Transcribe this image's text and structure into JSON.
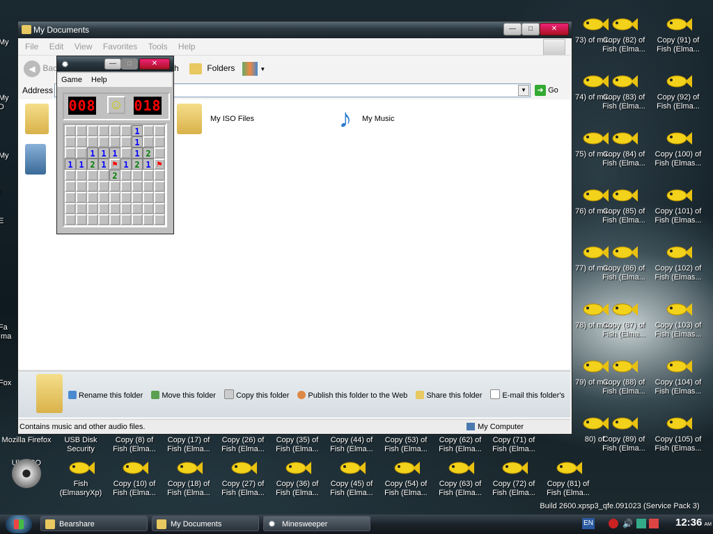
{
  "explorer": {
    "title": "My Documents",
    "menu": [
      "File",
      "Edit",
      "View",
      "Favorites",
      "Tools",
      "Help"
    ],
    "toolbar": {
      "back": "Back",
      "search": "h",
      "folders": "Folders"
    },
    "address_label": "Address",
    "go_label": "Go",
    "folders": [
      {
        "label": "My ISO Files"
      },
      {
        "label": "My Music"
      }
    ],
    "tasks": [
      "Rename this folder",
      "Move this folder",
      "Copy this folder",
      "Publish this folder to the Web",
      "Share this folder",
      "E-mail this folder's"
    ],
    "status_left": "Contains music and other audio files.",
    "status_right": "My Computer"
  },
  "minesweeper": {
    "menu": [
      "Game",
      "Help"
    ],
    "mines_left": "008",
    "timer": "018",
    "face": "☺",
    "grid": [
      "......1.",
      "......1.",
      "..111.12",
      "1121F121F",
      "....2...",
      "........",
      "........",
      "........",
      "........"
    ]
  },
  "desktop": {
    "left_partial": [
      "My",
      "My D",
      "My",
      "I",
      "E",
      "Fa Ima",
      "Fox"
    ],
    "right_cols": [
      [
        "73) of ma...",
        "74) of ma...",
        "75) of ma...",
        "76) of ma...",
        "77) of ma...",
        "78) of ma...",
        "79) of ma...",
        "80) of"
      ],
      [
        "Copy (82) of Fish (Elma...",
        "Copy (83) of Fish (Elma...",
        "Copy (84) of Fish (Elma...",
        "Copy (85) of Fish (Elma...",
        "Copy (86) of Fish (Elma...",
        "Copy (87) of Fish (Elma...",
        "Copy (88) of Fish (Elma...",
        "Copy (89) of Fish (Elma..."
      ],
      [
        "Copy (91) of Fish (Elma...",
        "Copy (92) of Fish (Elma...",
        "Copy (100) of Fish (Elmas...",
        "Copy (101) of Fish (Elmas...",
        "Copy (102) of Fish (Elmas...",
        "Copy (103) of Fish (Elmas...",
        "Copy (104) of Fish (Elmas...",
        "Copy (105) of Fish (Elmas..."
      ]
    ],
    "row1": [
      "Mozilla Firefox",
      "USB Disk Security",
      "Copy (8) of Fish (Elma...",
      "Copy (17) of Fish (Elma...",
      "Copy (26) of Fish (Elma...",
      "Copy (35) of Fish (Elma...",
      "Copy (44) of Fish (Elma...",
      "Copy (53) of Fish (Elma...",
      "Copy (62) of Fish (Elma...",
      "Copy (71) of Fish (Elma..."
    ],
    "row2": [
      "UltraISO",
      "Fish (ElmasryXp)",
      "Copy (10) of Fish (Elma...",
      "Copy (18) of Fish (Elma...",
      "Copy (27) of Fish (Elma...",
      "Copy (36) of Fish (Elma...",
      "Copy (45) of Fish (Elma...",
      "Copy (54) of Fish (Elma...",
      "Copy (63) of Fish (Elma...",
      "Copy (72) of Fish (Elma...",
      "Copy (81) of Fish (Elma..."
    ],
    "watermark": "Build 2600.xpsp3_qfe.091023 (Service Pack 3)"
  },
  "taskbar": {
    "buttons": [
      "Bearshare",
      "My Documents",
      "Minesweeper"
    ],
    "lang": "EN",
    "clock": "12:36",
    "ampm": "AM"
  },
  "colors": {
    "n1": "#0000ff",
    "n2": "#007b00",
    "flag": "#ff0000",
    "titlebar": "#2b3840"
  }
}
